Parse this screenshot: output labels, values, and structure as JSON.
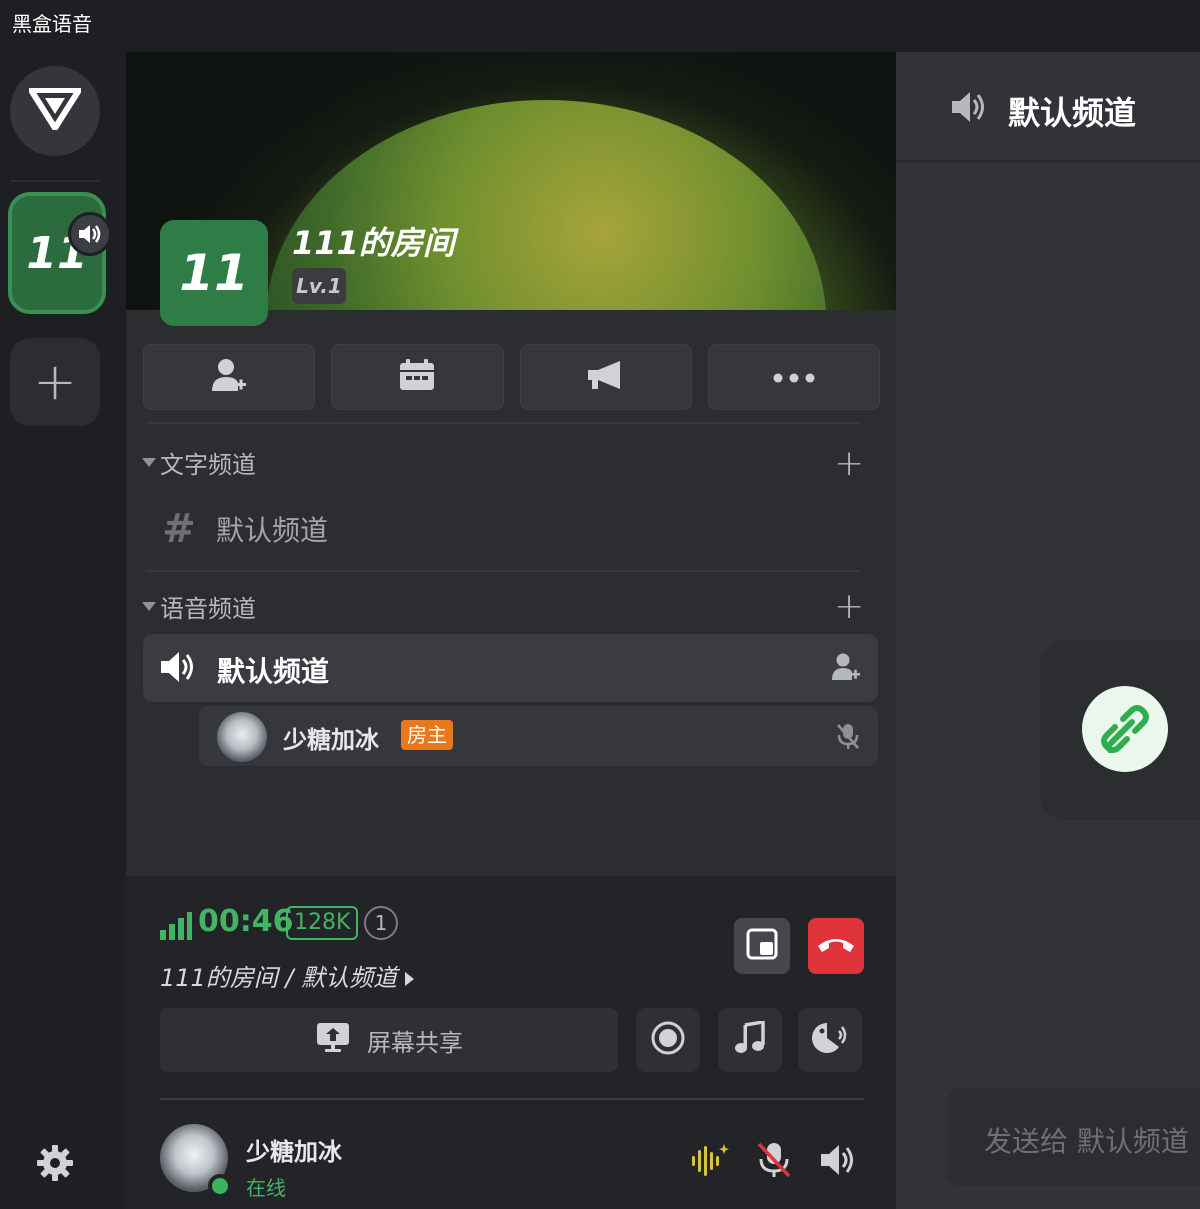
{
  "app": {
    "title": "黑盒语音"
  },
  "rail": {
    "server_tile_text": "11",
    "add_symbol": "+"
  },
  "room": {
    "avatar_text": "11",
    "name": "111的房间",
    "level": "Lv.1"
  },
  "categories": {
    "text": {
      "label": "文字频道",
      "add": "+"
    },
    "voice": {
      "label": "语音频道",
      "add": "+"
    }
  },
  "text_channels": [
    {
      "symbol": "#",
      "name": "默认频道"
    }
  ],
  "voice_channels": [
    {
      "name": "默认频道",
      "members": [
        {
          "name": "少糖加冰",
          "badge": "房主"
        }
      ]
    }
  ],
  "call": {
    "time": "00:46",
    "bitrate": "128K",
    "member_count": "1",
    "path": "111的房间 / 默认频道",
    "share_label": "屏幕共享"
  },
  "self": {
    "name": "少糖加冰",
    "status": "在线"
  },
  "chat": {
    "title": "默认频道",
    "input_placeholder": "发送给 默认频道"
  },
  "colors": {
    "accent_green": "#43b463",
    "hangup_red": "#e0343b",
    "owner_orange": "#e8781c",
    "server_green": "#2e7d46"
  },
  "icons": [
    "logo-icon",
    "speaker-icon",
    "plus-icon",
    "gear-icon",
    "add-user-icon",
    "calendar-icon",
    "megaphone-icon",
    "more-icon",
    "hash-icon",
    "mic-off-icon",
    "signal-icon",
    "pip-icon",
    "hangup-icon",
    "screen-share-icon",
    "record-icon",
    "music-icon",
    "soundboard-icon",
    "noise-suppress-icon",
    "link-icon"
  ]
}
